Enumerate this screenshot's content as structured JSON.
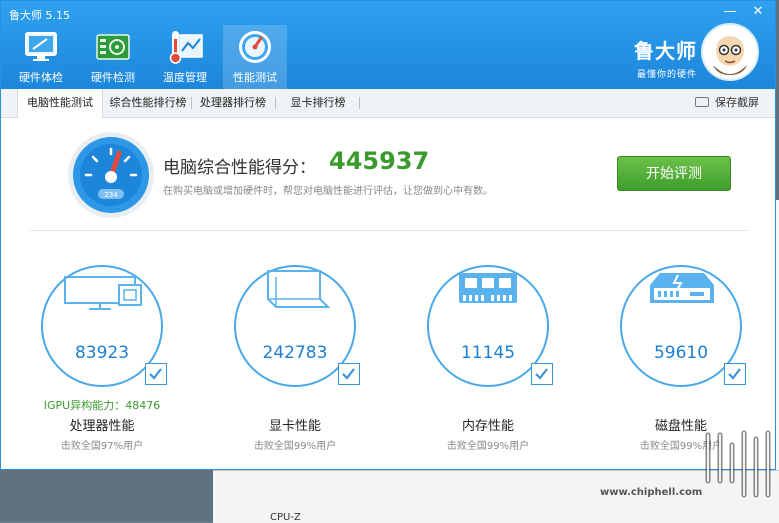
{
  "app": {
    "title": "鲁大师 5.15"
  },
  "window_controls": {
    "minimize": "—",
    "close": "✕"
  },
  "nav": [
    {
      "label": "硬件体检",
      "icon": "monitor-icon"
    },
    {
      "label": "硬件检测",
      "icon": "circuit-board-icon"
    },
    {
      "label": "温度管理",
      "icon": "thermometer-icon"
    },
    {
      "label": "性能测试",
      "icon": "speedometer-icon",
      "active": true
    }
  ],
  "brand": {
    "name": "鲁大师",
    "slogan": "最懂你的硬件"
  },
  "subtabs": [
    {
      "label": "电脑性能测试",
      "active": true
    },
    {
      "label": "综合性能排行榜"
    },
    {
      "label": "处理器排行榜"
    },
    {
      "label": "显卡排行榜"
    }
  ],
  "save_screenshot": "保存截屏",
  "score": {
    "title": "电脑综合性能得分：",
    "value": "445937",
    "subtitle": "在购买电脑或增加硬件时，帮您对电脑性能进行评估，让您做到心中有数。",
    "gauge_digits": "234"
  },
  "start_button": "开始评测",
  "cards": [
    {
      "value": "83923",
      "name": "处理器性能",
      "desc": "击败全国97%用户",
      "extra": "IGPU异构能力：48476",
      "icon": "cpu-monitor-icon"
    },
    {
      "value": "242783",
      "name": "显卡性能",
      "desc": "击败全国99%用户",
      "icon": "graphics-cube-icon"
    },
    {
      "value": "11145",
      "name": "内存性能",
      "desc": "击败全国99%用户",
      "icon": "memory-chip-icon"
    },
    {
      "value": "59610",
      "name": "磁盘性能",
      "desc": "击败全国99%用户",
      "icon": "disk-drive-icon"
    }
  ],
  "watermark": {
    "url": "www.chiphell.com"
  },
  "background_text": "CPU-Z",
  "colors": {
    "accent_blue": "#1d86da",
    "score_green": "#3a9a2c",
    "button_green": "#4fae35",
    "ring_blue": "#4aa8e8"
  }
}
